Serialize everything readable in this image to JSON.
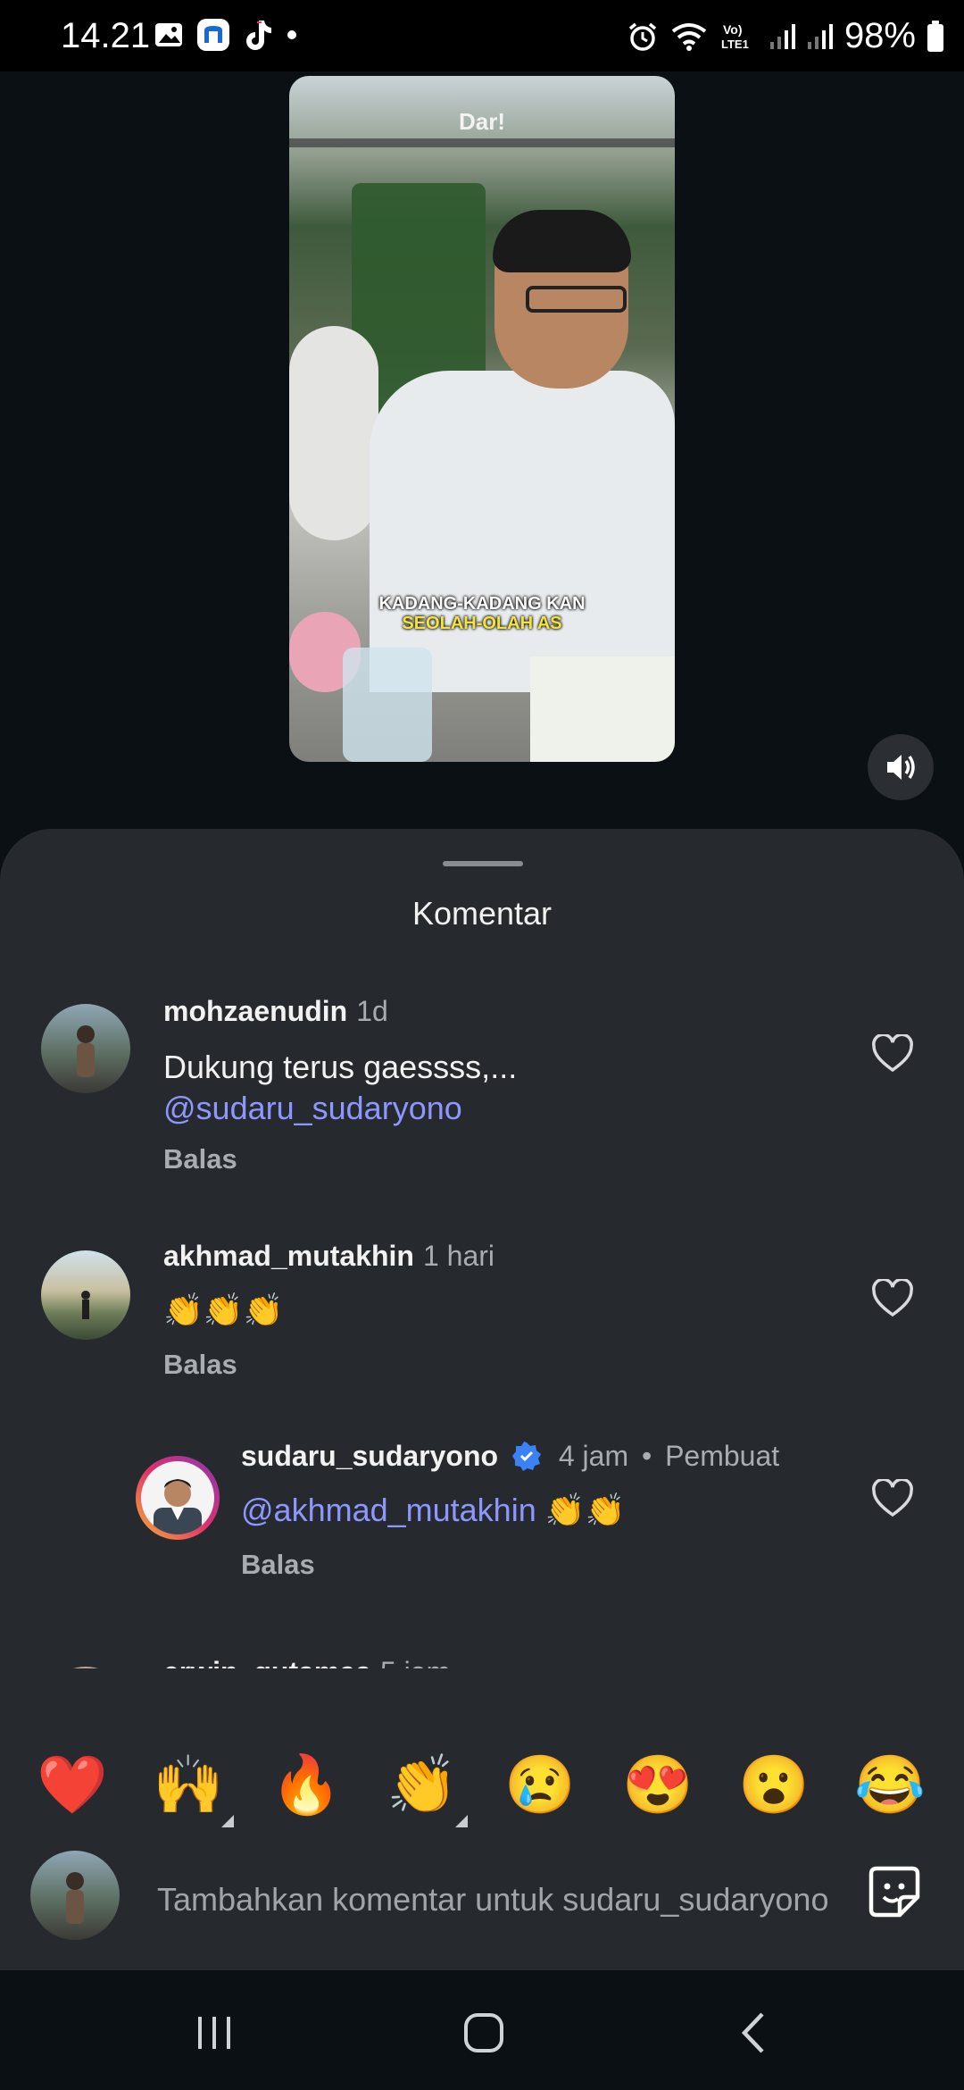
{
  "status_bar": {
    "time": "14.21",
    "battery": "98%",
    "icons_left": [
      "gallery-icon",
      "app-icon",
      "tiktok-icon",
      "dot-icon"
    ],
    "icons_right": [
      "alarm-icon",
      "wifi-icon",
      "volte-icon",
      "signal-icon",
      "signal-icon",
      "battery-icon"
    ],
    "network_label": "Vo) LTE1"
  },
  "video": {
    "watermark": "Dar!",
    "caption_line1": "KADANG-KADANG KAN",
    "caption_line2": "SEOLAH-OLAH AS",
    "mute_icon": "speaker-icon"
  },
  "sheet": {
    "title": "Komentar"
  },
  "comments": [
    {
      "username": "mohzaenudin",
      "time": "1d",
      "text_line1": "Dukung terus gaessss,...",
      "mention": "@sudaru_sudaryono",
      "reply_label": "Balas"
    },
    {
      "username": "akhmad_mutakhin",
      "time": "1 hari",
      "text": "👏👏👏",
      "reply_label": "Balas"
    },
    {
      "username": "sudaru_sudaryono",
      "time": "4 jam",
      "badge": "Pembuat",
      "verified": true,
      "mention": "@akhmad_mutakhin",
      "text": "👏👏",
      "reply_label": "Balas",
      "nested": true
    },
    {
      "username": "erwin_gutamaa",
      "time": "5 jam",
      "text": "👍👍🔥🔥"
    }
  ],
  "reactions": [
    "❤️",
    "🙌",
    "🔥",
    "👏",
    "😢",
    "😍",
    "😮",
    "😂"
  ],
  "composer": {
    "placeholder": "Tambahkan komentar untuk sudaru_sudaryono"
  },
  "colors": {
    "sheet_bg": "#262a2e",
    "mention": "#8d97ff",
    "verified": "#3b82f6",
    "muted_text": "#a9acb0"
  }
}
